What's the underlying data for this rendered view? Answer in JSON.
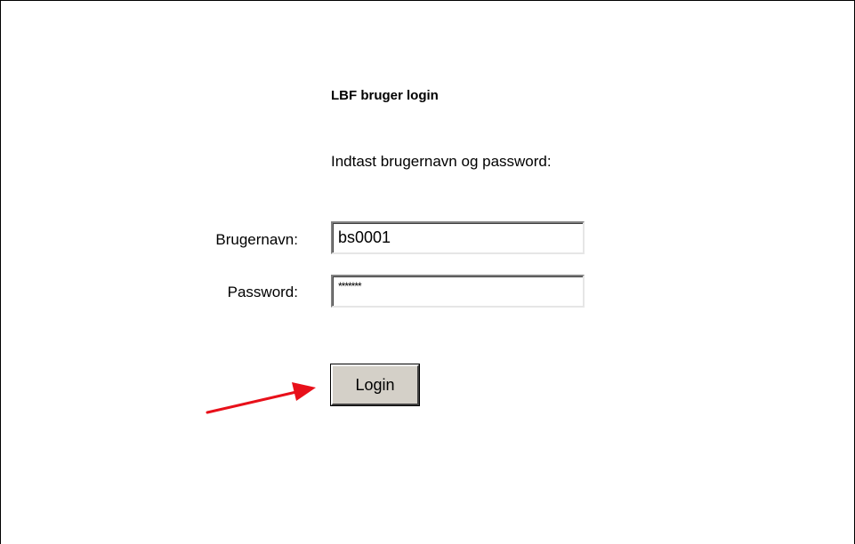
{
  "login_form": {
    "title": "LBF bruger login",
    "instruction": "Indtast brugernavn og password:",
    "username_label": "Brugernavn:",
    "username_value": "bs0001",
    "password_label": "Password:",
    "password_value": "*******",
    "login_button_label": "Login"
  },
  "annotation": {
    "arrow_icon": "arrow-pointing-to-login-button",
    "arrow_color": "#e8101a"
  }
}
